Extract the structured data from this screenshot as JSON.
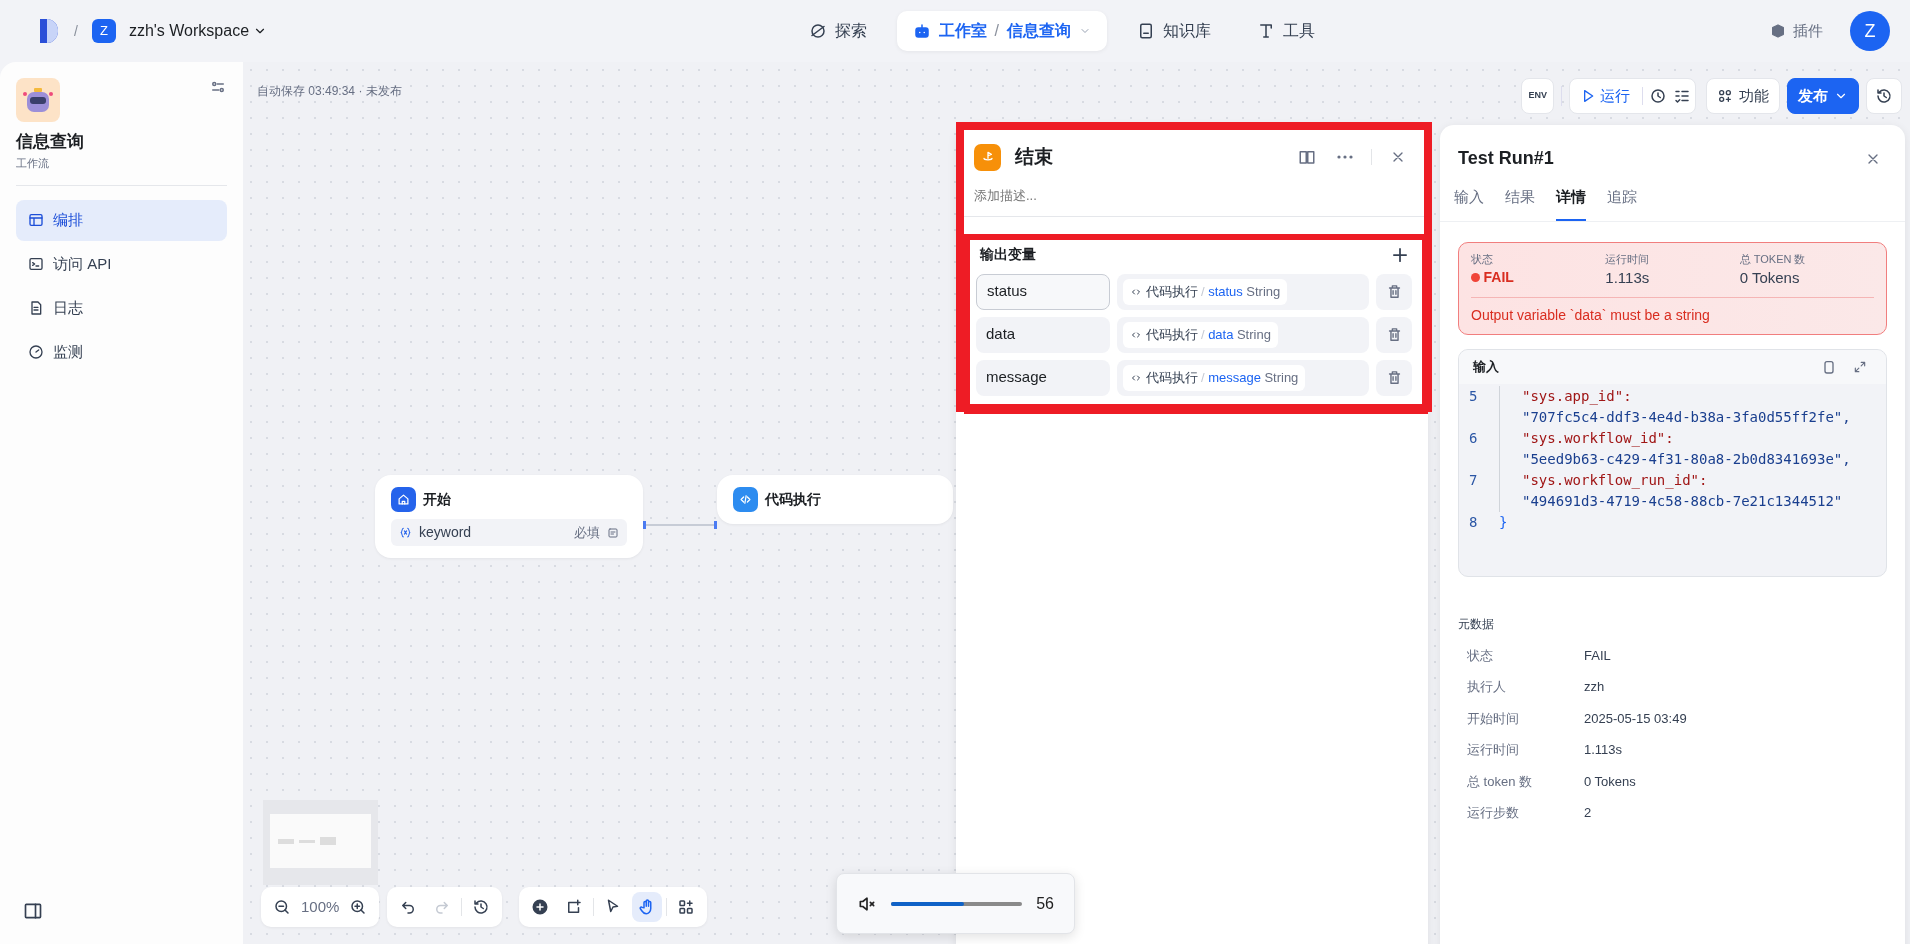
{
  "topbar": {
    "separator": "/",
    "workspace_initial": "Z",
    "workspace": "zzh's Workspace",
    "nav": [
      {
        "kind": "explore",
        "label": "探索",
        "selected": false
      },
      {
        "kind": "studio",
        "label": "工作室",
        "selected": true,
        "crumb_separator": "/",
        "crumb": "信息查询"
      },
      {
        "kind": "knowledge",
        "label": "知识库",
        "selected": false
      },
      {
        "kind": "tools",
        "label": "工具",
        "selected": false
      }
    ],
    "plugins": "插件",
    "avatar": "Z"
  },
  "sidebar": {
    "app_name": "信息查询",
    "app_type": "工作流",
    "items": [
      {
        "kind": "layout",
        "label": "编排",
        "selected": true
      },
      {
        "kind": "terminal",
        "label": "访问 API",
        "selected": false
      },
      {
        "kind": "log",
        "label": "日志",
        "selected": false
      },
      {
        "kind": "monitor",
        "label": "监测",
        "selected": false
      }
    ]
  },
  "canvas": {
    "autosave": "自动保存 03:49:34 · 未发布",
    "env": "ENV",
    "run": "运行",
    "features": "功能",
    "publish": "发布",
    "zoom": "100%",
    "nodes": [
      {
        "kind": "start",
        "title": "开始",
        "variables": [
          {
            "name": "keyword",
            "required": "必填"
          }
        ]
      },
      {
        "kind": "code",
        "title": "代码执行"
      }
    ],
    "tools": [
      {
        "kind": "add",
        "selected": false
      },
      {
        "kind": "note",
        "selected": false
      },
      {
        "kind": "pointer",
        "selected": false
      },
      {
        "kind": "hand",
        "selected": true
      },
      {
        "kind": "organize",
        "selected": false
      }
    ]
  },
  "end_panel": {
    "title": "结束",
    "description_placeholder": "添加描述...",
    "section": "输出变量",
    "outputs": [
      {
        "name": "status",
        "focused": true,
        "source": "代码执行",
        "separator": "/",
        "field": "status",
        "type": "String"
      },
      {
        "name": "data",
        "focused": false,
        "source": "代码执行",
        "separator": "/",
        "field": "data",
        "type": "String"
      },
      {
        "name": "message",
        "focused": false,
        "source": "代码执行",
        "separator": "/",
        "field": "message",
        "type": "String"
      }
    ]
  },
  "test_run": {
    "title": "Test Run#1",
    "tabs": [
      {
        "label": "输入",
        "selected": false
      },
      {
        "label": "结果",
        "selected": false
      },
      {
        "label": "详情",
        "selected": true
      },
      {
        "label": "追踪",
        "selected": false
      }
    ],
    "summary": {
      "status_label": "状态",
      "status": "FAIL",
      "time_label": "运行时间",
      "time": "1.113s",
      "tokens_label": "总 TOKEN 数",
      "tokens": "0 Tokens",
      "error": "Output variable `data` must be a string"
    },
    "input": {
      "title": "输入",
      "lines": [
        {
          "number": "5",
          "key": "\"sys.app_id\":",
          "value": "\"707fc5c4-ddf3-4e4d-b38a-3fa0d55ff2fe\","
        },
        {
          "number": "6",
          "key": "\"sys.workflow_id\":",
          "value": "\"5eed9b63-c429-4f31-80a8-2b0d8341693e\","
        },
        {
          "number": "7",
          "key": "\"sys.workflow_run_id\":",
          "value": "\"494691d3-4719-4c58-88cb-7e21c1344512\""
        },
        {
          "number": "8",
          "brace": "}"
        }
      ]
    },
    "metadata": {
      "title": "元数据",
      "rows": [
        {
          "label": "状态",
          "value": "FAIL"
        },
        {
          "label": "执行人",
          "value": "zzh"
        },
        {
          "label": "开始时间",
          "value": "2025-05-15 03:49"
        },
        {
          "label": "运行时间",
          "value": "1.113s"
        },
        {
          "label": "总 token 数",
          "value": "0 Tokens"
        },
        {
          "label": "运行步数",
          "value": "2"
        }
      ]
    }
  },
  "volume": {
    "level": 0.56,
    "reading": "56"
  }
}
